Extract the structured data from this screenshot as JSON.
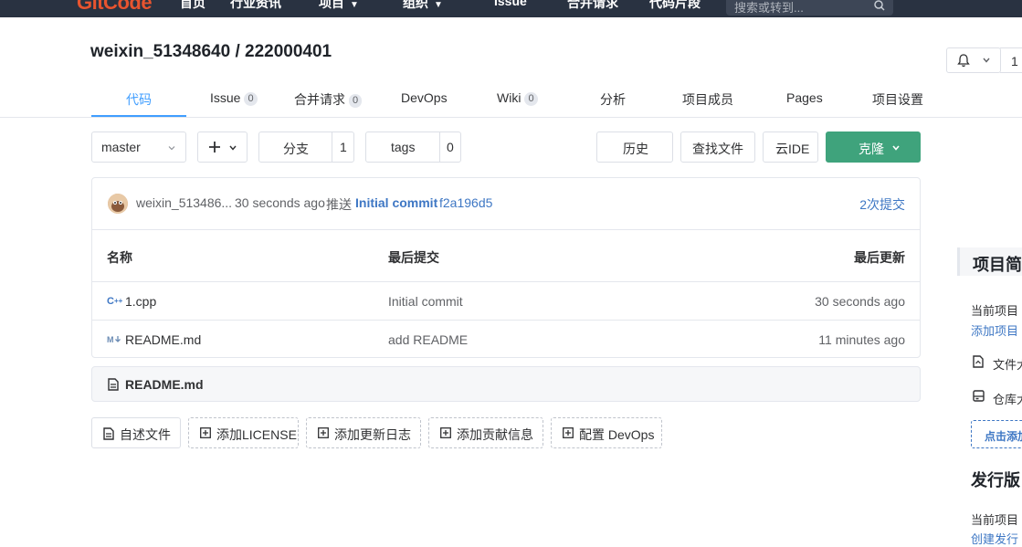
{
  "topnav": {
    "logo": "GitCode",
    "items": [
      "首页",
      "行业资讯",
      "项目",
      "组织",
      "Issue",
      "合并请求",
      "代码片段"
    ],
    "search_placeholder": "搜索或转到..."
  },
  "repo": {
    "title": "weixin_51348640 / 222000401",
    "watch_count": "1"
  },
  "tabs": [
    {
      "label": "代码",
      "badge": ""
    },
    {
      "label": "Issue",
      "badge": "0"
    },
    {
      "label": "合并请求",
      "badge": "0"
    },
    {
      "label": "DevOps",
      "badge": ""
    },
    {
      "label": "Wiki",
      "badge": "0"
    },
    {
      "label": "分析",
      "badge": ""
    },
    {
      "label": "项目成员",
      "badge": ""
    },
    {
      "label": "Pages",
      "badge": ""
    },
    {
      "label": "项目设置",
      "badge": ""
    }
  ],
  "toolbar": {
    "branch": "master",
    "branches_label": "分支",
    "branches_count": "1",
    "tags_label": "tags",
    "tags_count": "0",
    "history": "历史",
    "find_file": "查找文件",
    "cloud_ide": "云IDE",
    "clone": "克隆"
  },
  "commit": {
    "author": "weixin_513486...",
    "time": "30 seconds ago",
    "action": "推送",
    "message": "Initial commit",
    "sha": "f2a196d5",
    "count": "2次提交"
  },
  "table": {
    "headers": [
      "名称",
      "最后提交",
      "最后更新"
    ],
    "rows": [
      {
        "name": "1.cpp",
        "icon": "cpp-file-icon",
        "commit": "Initial commit",
        "updated": "30 seconds ago"
      },
      {
        "name": "README.md",
        "icon": "markdown-file-icon",
        "commit": "add README",
        "updated": "11 minutes ago"
      }
    ]
  },
  "readme": {
    "title": "README.md"
  },
  "actions": [
    "自述文件",
    "添加LICENSE",
    "添加更新日志",
    "添加贡献信息",
    "配置 DevOps"
  ],
  "sidebar": {
    "intro_title": "项目简",
    "intro_text": "当前项目",
    "add_intro": "添加项目",
    "files": "文件大",
    "storage": "仓库大",
    "click_add": "点击添加",
    "release_title": "发行版",
    "release_text": "当前项目",
    "create_release": "创建发行"
  },
  "colors": {
    "accent": "#409eff",
    "clone": "#3fa37c",
    "nav_bg": "#293241",
    "link": "#3e77c4"
  }
}
